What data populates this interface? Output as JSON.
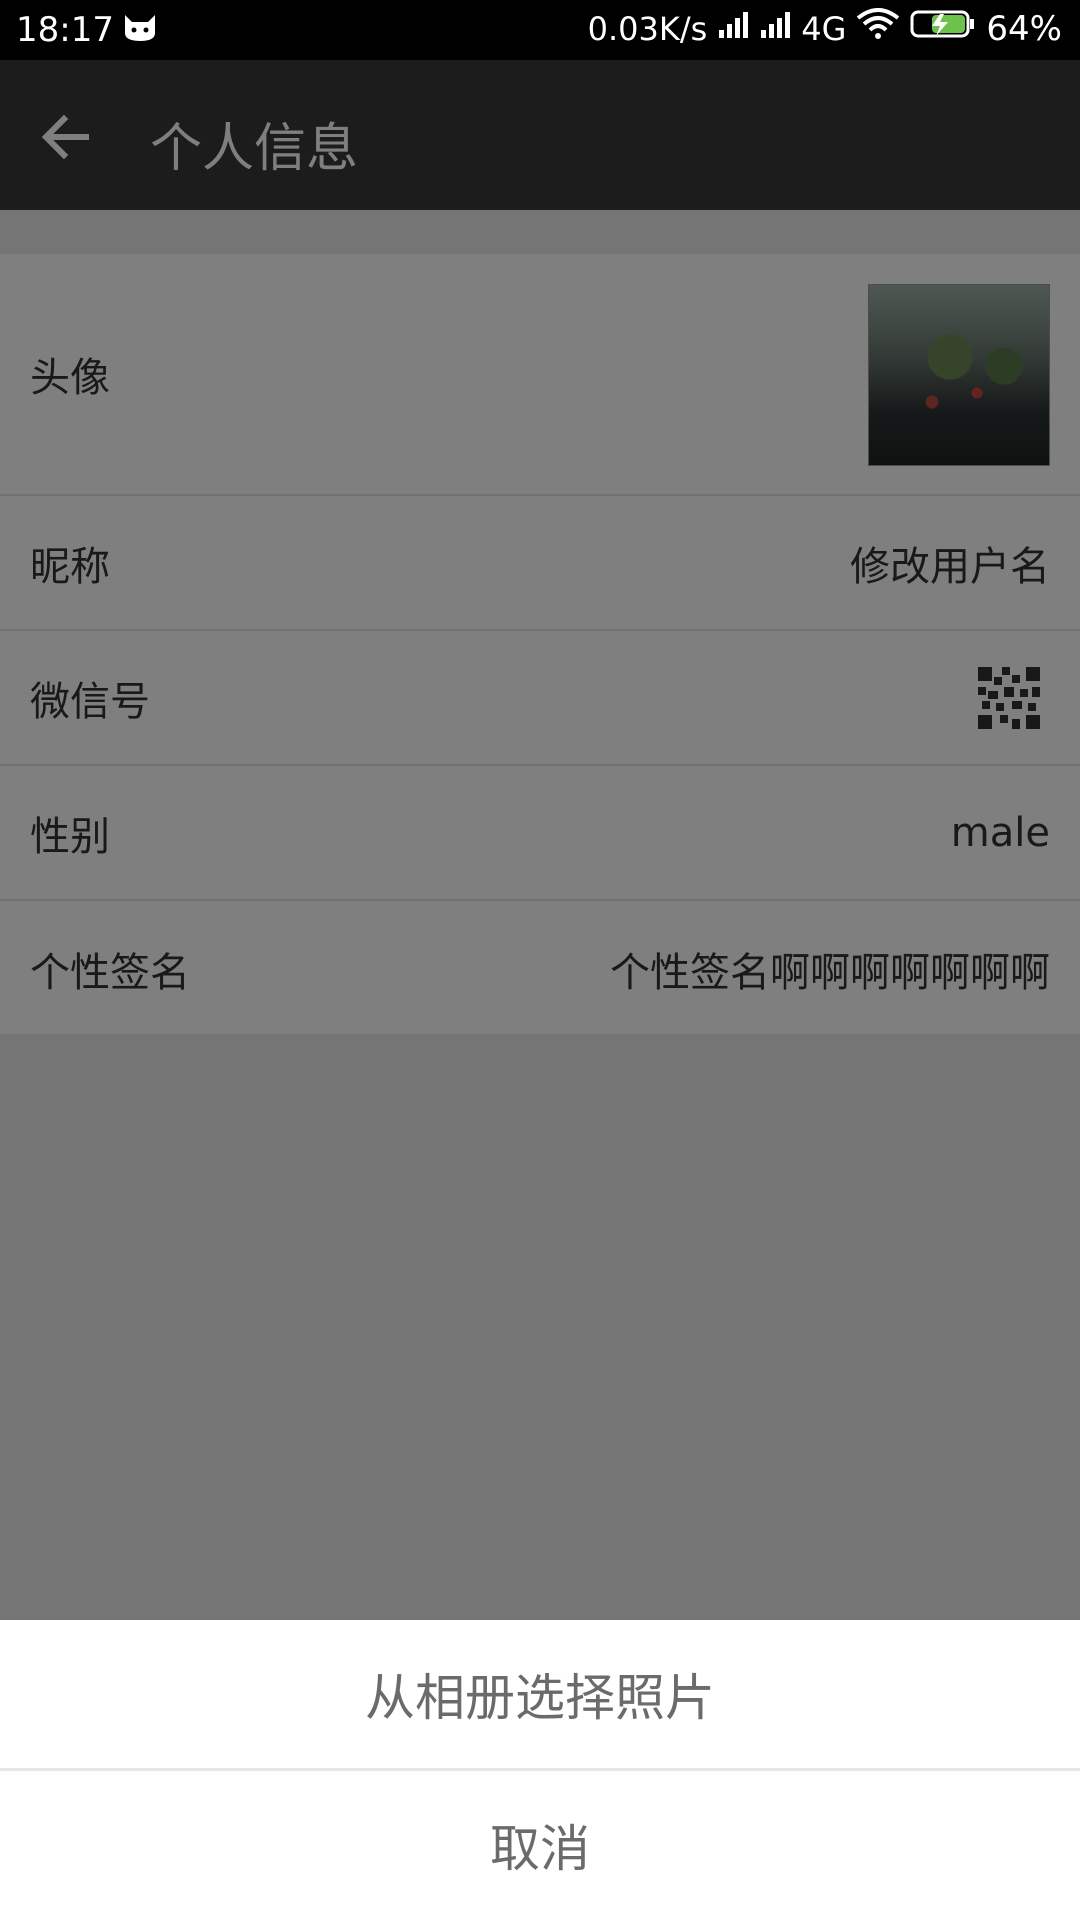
{
  "status_bar": {
    "time": "18:17",
    "network_speed": "0.03K/s",
    "network_type": "4G",
    "battery_percent": "64%",
    "icons": [
      "cat-notification-icon",
      "signal-icon",
      "signal-icon",
      "wifi-icon",
      "battery-charging-icon"
    ]
  },
  "toolbar": {
    "title": "个人信息",
    "back_icon": "arrow-left-icon"
  },
  "profile": {
    "avatar_label": "头像",
    "nickname_label": "昵称",
    "nickname_value": "修改用户名",
    "wechat_id_label": "微信号",
    "qr_icon": "qr-code-icon",
    "gender_label": "性别",
    "gender_value": "male",
    "signature_label": "个性签名",
    "signature_value": "个性签名啊啊啊啊啊啊啊"
  },
  "action_sheet": {
    "choose_photo": "从相册选择照片",
    "cancel": "取消"
  },
  "colors": {
    "toolbar_bg": "#393939",
    "overlay": "rgba(0,0,0,0.5)",
    "sheet_text": "#6b6b6b"
  }
}
